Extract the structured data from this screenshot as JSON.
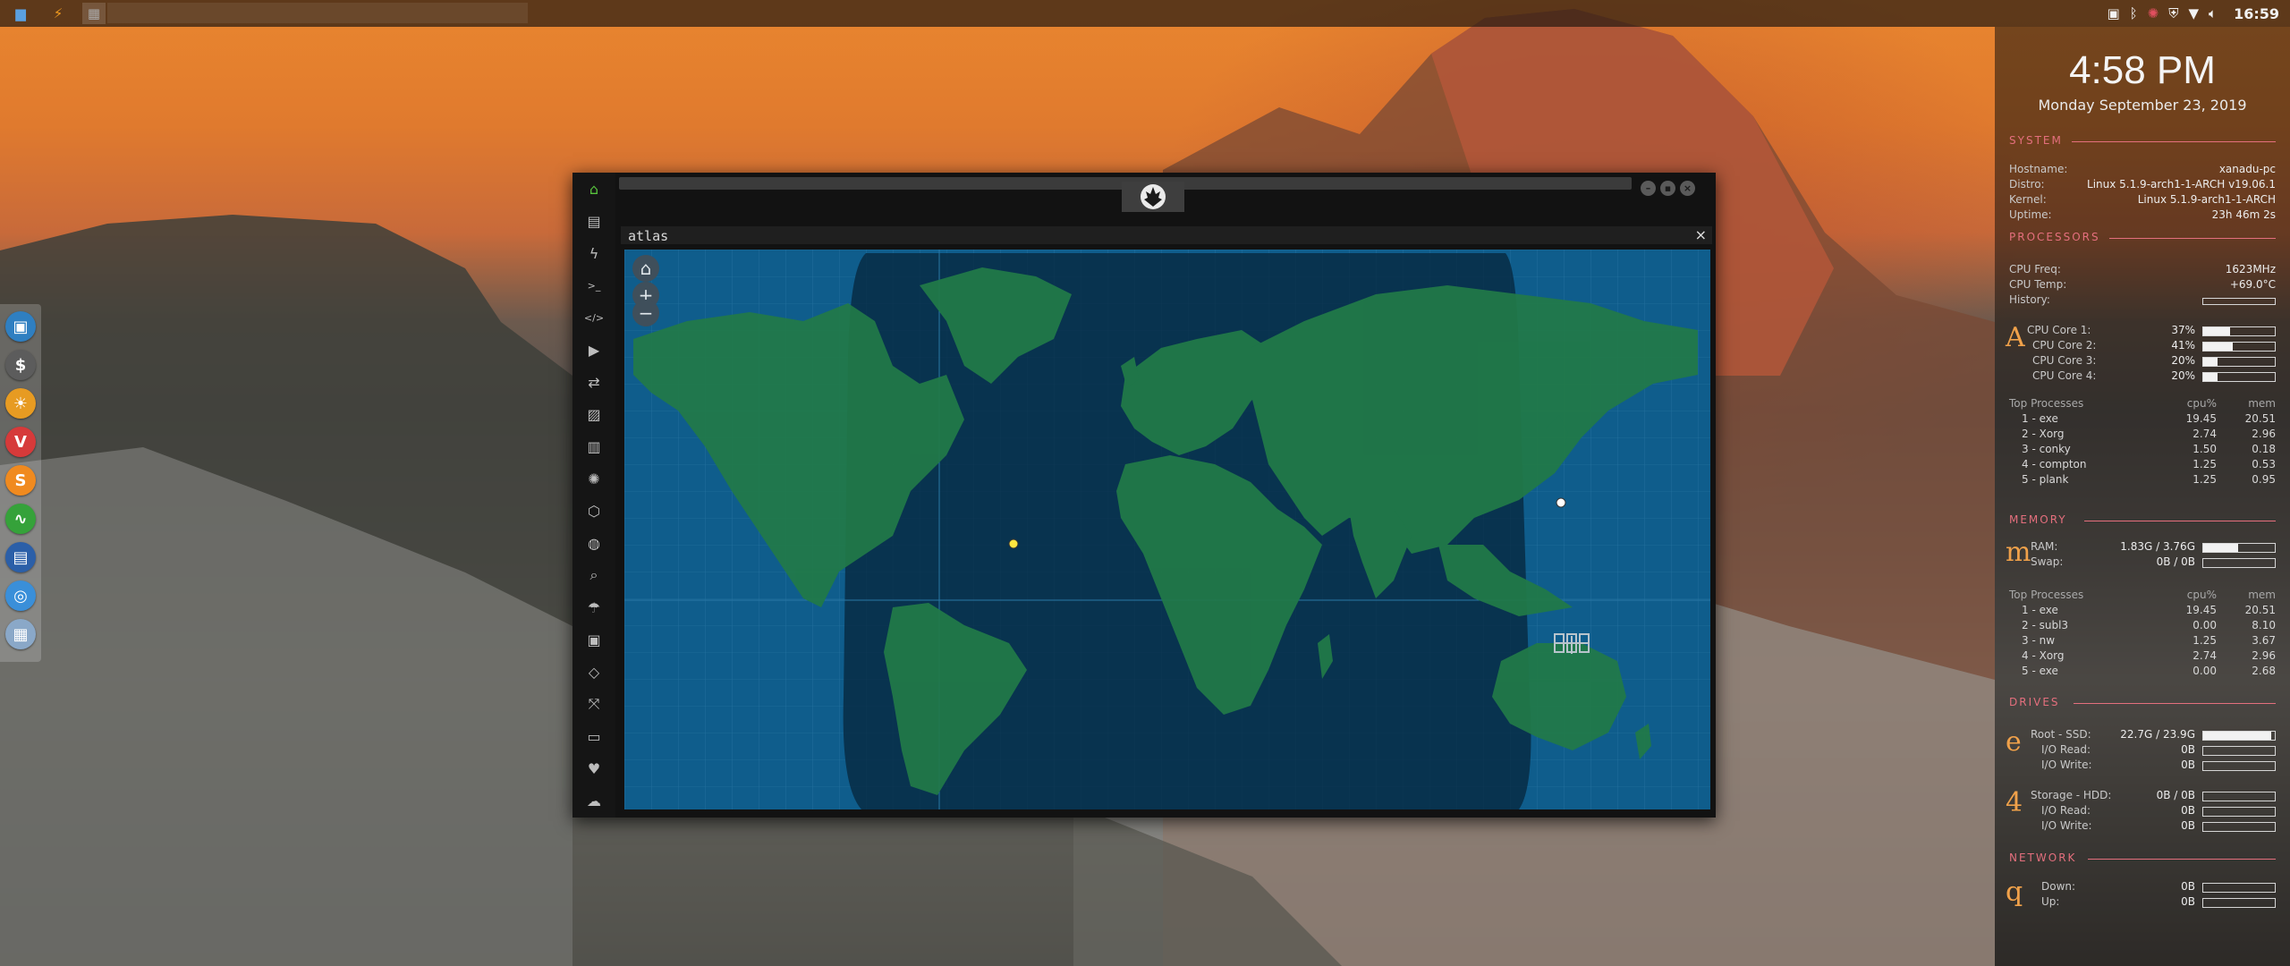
{
  "topbar": {
    "time": "16:59",
    "apps": [
      "file-manager-icon",
      "sublime-text-icon",
      "grid-app-icon"
    ],
    "tray": [
      "image-tray-icon",
      "bluetooth-icon",
      "settings-gear-icon",
      "vpn-icon",
      "wifi-icon",
      "volume-icon"
    ]
  },
  "dock": {
    "items": [
      {
        "name": "dock-files-icon",
        "glyph": "▣",
        "color": "#2f7fc1"
      },
      {
        "name": "dock-terminal-icon",
        "glyph": "$",
        "color": "#5c5c5c"
      },
      {
        "name": "dock-sun-icon",
        "glyph": "☀",
        "color": "#e79b22"
      },
      {
        "name": "dock-vivaldi-icon",
        "glyph": "V",
        "color": "#d63a3a"
      },
      {
        "name": "dock-sublime-icon",
        "glyph": "S",
        "color": "#f08a1f"
      },
      {
        "name": "dock-monitor-icon",
        "glyph": "∿",
        "color": "#35a23a"
      },
      {
        "name": "dock-remote-icon",
        "glyph": "▤",
        "color": "#2b5fa8"
      },
      {
        "name": "dock-chrome-icon",
        "glyph": "◎",
        "color": "#3a8fd9"
      },
      {
        "name": "dock-grid-icon",
        "glyph": "▦",
        "color": "#8aa8c8"
      }
    ]
  },
  "window": {
    "panel_title": "atlas",
    "close_glyph": "×",
    "controls": {
      "minimize": "–",
      "maximize": "▪",
      "close": "×"
    },
    "sidebar": [
      {
        "name": "home-icon",
        "glyph": "⌂",
        "color": "#58c33d"
      },
      {
        "name": "document-icon",
        "glyph": "▤"
      },
      {
        "name": "bolt-icon",
        "glyph": "ϟ"
      },
      {
        "name": "terminal-icon",
        "glyph": ">_"
      },
      {
        "name": "code-icon",
        "glyph": "</>"
      },
      {
        "name": "play-icon",
        "glyph": "▶"
      },
      {
        "name": "translate-icon",
        "glyph": "⇄"
      },
      {
        "name": "image-icon",
        "glyph": "▨"
      },
      {
        "name": "news-icon",
        "glyph": "▥"
      },
      {
        "name": "atom-icon",
        "glyph": "✺"
      },
      {
        "name": "hexagon-icon",
        "glyph": "⬡"
      },
      {
        "name": "globe-icon",
        "glyph": "◍"
      },
      {
        "name": "search-icon",
        "glyph": "⌕"
      },
      {
        "name": "umbrella-icon",
        "glyph": "☂"
      },
      {
        "name": "contact-icon",
        "glyph": "▣"
      },
      {
        "name": "tag-icon",
        "glyph": "◇"
      },
      {
        "name": "expand-icon",
        "glyph": "⤧"
      },
      {
        "name": "youtube-icon",
        "glyph": "▭"
      },
      {
        "name": "heart-icon",
        "glyph": "♥"
      },
      {
        "name": "cloud-icon",
        "glyph": "☁"
      }
    ],
    "map_controls": {
      "home": "⌂",
      "zoom_in": "+",
      "zoom_out": "−"
    }
  },
  "conky": {
    "time": "4:58 PM",
    "date": "Monday September 23, 2019",
    "system": {
      "heading": "SYSTEM",
      "rows": [
        {
          "k": "Hostname:",
          "v": "xanadu-pc"
        },
        {
          "k": "Distro:",
          "v": "Linux 5.1.9-arch1-1-ARCH v19.06.1"
        },
        {
          "k": "Kernel:",
          "v": "Linux 5.1.9-arch1-1-ARCH"
        },
        {
          "k": "Uptime:",
          "v": "23h 46m 2s"
        }
      ]
    },
    "processors": {
      "heading": "PROCESSORS",
      "freq_label": "CPU Freq:",
      "freq": "1623MHz",
      "temp_label": "CPU Temp:",
      "temp": "+69.0°C",
      "history_label": "History:",
      "glyph": "A",
      "cores": [
        {
          "k": "CPU Core 1:",
          "v": "37%",
          "level": 0.37
        },
        {
          "k": "CPU Core 2:",
          "v": "41%",
          "level": 0.41
        },
        {
          "k": "CPU Core 3:",
          "v": "20%",
          "level": 0.2
        },
        {
          "k": "CPU Core 4:",
          "v": "20%",
          "level": 0.2
        }
      ],
      "top_label": "Top Processes",
      "cpu_label": "cpu%",
      "mem_label": "mem",
      "top": [
        {
          "n": "1 - exe",
          "c": "19.45",
          "m": "20.51"
        },
        {
          "n": "2 - Xorg",
          "c": "2.74",
          "m": "2.96"
        },
        {
          "n": "3 - conky",
          "c": "1.50",
          "m": "0.18"
        },
        {
          "n": "4 - compton",
          "c": "1.25",
          "m": "0.53"
        },
        {
          "n": "5 - plank",
          "c": "1.25",
          "m": "0.95"
        }
      ]
    },
    "memory": {
      "heading": "MEMORY",
      "glyph": "m",
      "ram_label": "RAM:",
      "ram": "1.83G / 3.76G",
      "ram_level": 0.49,
      "swap_label": "Swap:",
      "swap": "0B / 0B",
      "swap_level": 0,
      "top_label": "Top Processes",
      "cpu_label": "cpu%",
      "mem_label": "mem",
      "top": [
        {
          "n": "1 - exe",
          "c": "19.45",
          "m": "20.51"
        },
        {
          "n": "2 - subl3",
          "c": "0.00",
          "m": "8.10"
        },
        {
          "n": "3 - nw",
          "c": "1.25",
          "m": "3.67"
        },
        {
          "n": "4 - Xorg",
          "c": "2.74",
          "m": "2.96"
        },
        {
          "n": "5 - exe",
          "c": "0.00",
          "m": "2.68"
        }
      ]
    },
    "drives": {
      "heading": "DRIVES",
      "glyph_root": "e",
      "root_label": "Root - SSD:",
      "root": "22.7G / 23.9G",
      "root_level": 0.95,
      "root_read_label": "I/O Read:",
      "root_read": "0B",
      "root_write_label": "I/O Write:",
      "root_write": "0B",
      "glyph_storage": "4",
      "storage_label": "Storage - HDD:",
      "storage": "0B / 0B",
      "storage_read_label": "I/O Read:",
      "storage_read": "0B",
      "storage_write_label": "I/O Write:",
      "storage_write": "0B"
    },
    "network": {
      "heading": "NETWORK",
      "glyph": "q",
      "down_label": "Down:",
      "down": "0B",
      "up_label": "Up:",
      "up": "0B"
    }
  }
}
